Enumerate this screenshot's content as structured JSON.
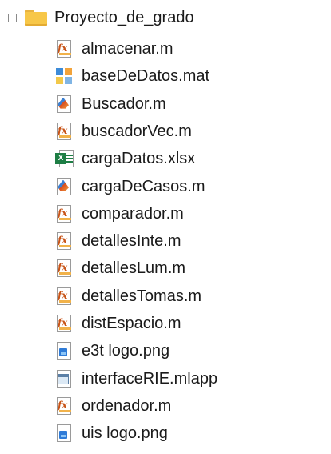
{
  "folder": {
    "name": "Proyecto_de_grado",
    "expanded": true,
    "icon": "folder-icon",
    "toggle_icon": "collapse-minus-icon"
  },
  "files": [
    {
      "name": "almacenar.m",
      "icon": "matlab-function-icon"
    },
    {
      "name": "baseDeDatos.mat",
      "icon": "mat-data-icon"
    },
    {
      "name": "Buscador.m",
      "icon": "matlab-script-icon"
    },
    {
      "name": "buscadorVec.m",
      "icon": "matlab-function-icon"
    },
    {
      "name": "cargaDatos.xlsx",
      "icon": "excel-icon"
    },
    {
      "name": "cargaDeCasos.m",
      "icon": "matlab-script-icon"
    },
    {
      "name": "comparador.m",
      "icon": "matlab-function-icon"
    },
    {
      "name": "detallesInte.m",
      "icon": "matlab-function-icon"
    },
    {
      "name": "detallesLum.m",
      "icon": "matlab-function-icon"
    },
    {
      "name": "detallesTomas.m",
      "icon": "matlab-function-icon"
    },
    {
      "name": "distEspacio.m",
      "icon": "matlab-function-icon"
    },
    {
      "name": "e3t logo.png",
      "icon": "image-file-icon"
    },
    {
      "name": "interfaceRIE.mlapp",
      "icon": "matlab-app-icon"
    },
    {
      "name": "ordenador.m",
      "icon": "matlab-function-icon"
    },
    {
      "name": "uis logo.png",
      "icon": "image-file-icon"
    }
  ]
}
